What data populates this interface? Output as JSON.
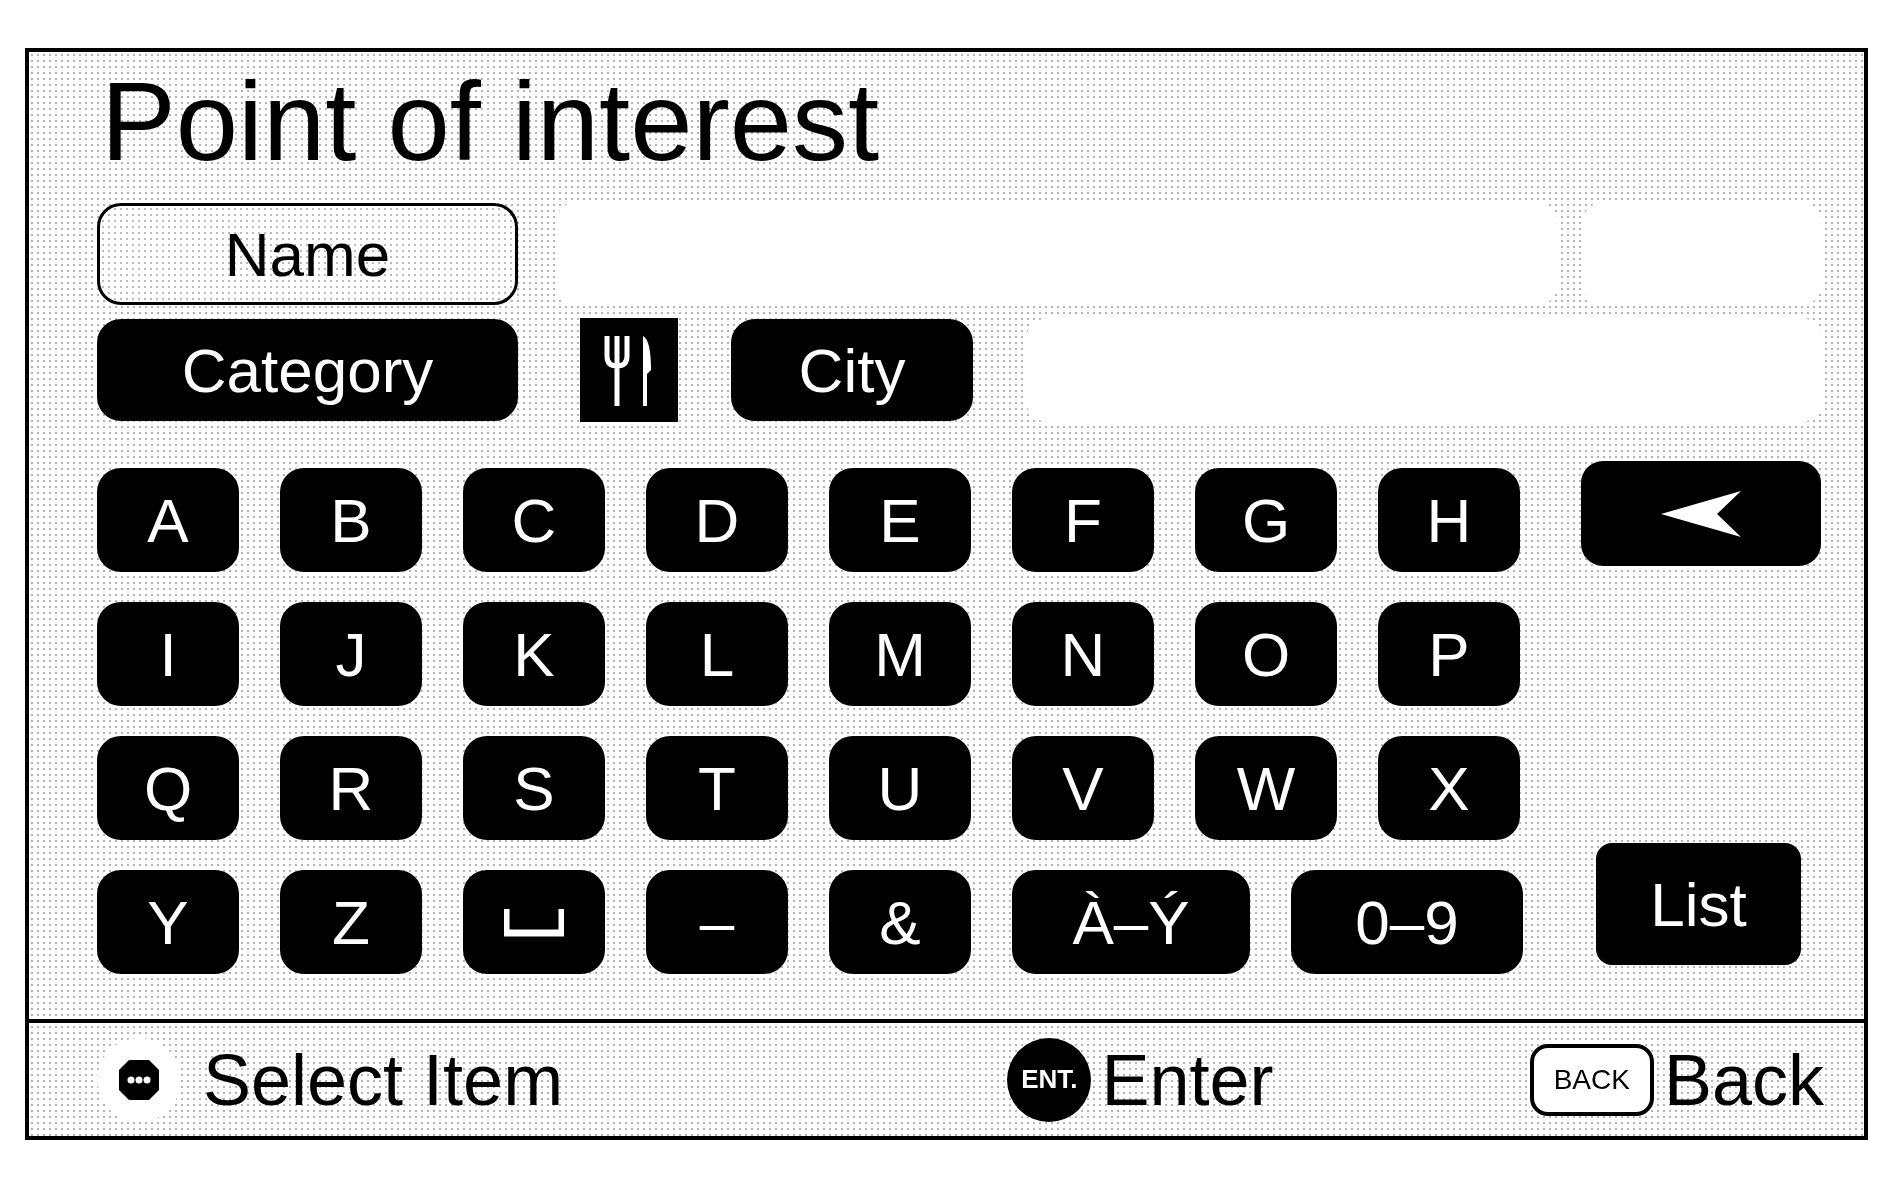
{
  "title": "Point of interest",
  "name_button": {
    "label": "Name",
    "selected": true
  },
  "category_button": {
    "label": "Category",
    "selected": false
  },
  "city_button": {
    "label": "City",
    "selected": false
  },
  "keyboard": {
    "letter_rows": [
      [
        {
          "kind": "letter",
          "label": "A"
        },
        {
          "kind": "letter",
          "label": "B"
        },
        {
          "kind": "letter",
          "label": "C"
        },
        {
          "kind": "letter",
          "label": "D"
        },
        {
          "kind": "letter",
          "label": "E"
        },
        {
          "kind": "letter",
          "label": "F"
        },
        {
          "kind": "letter",
          "label": "G"
        },
        {
          "kind": "letter",
          "label": "H"
        }
      ],
      [
        {
          "kind": "letter",
          "label": "I"
        },
        {
          "kind": "letter",
          "label": "J"
        },
        {
          "kind": "letter",
          "label": "K"
        },
        {
          "kind": "letter",
          "label": "L"
        },
        {
          "kind": "letter",
          "label": "M"
        },
        {
          "kind": "letter",
          "label": "N"
        },
        {
          "kind": "letter",
          "label": "O"
        },
        {
          "kind": "letter",
          "label": "P"
        }
      ],
      [
        {
          "kind": "letter",
          "label": "Q"
        },
        {
          "kind": "letter",
          "label": "R"
        },
        {
          "kind": "letter",
          "label": "S"
        },
        {
          "kind": "letter",
          "label": "T"
        },
        {
          "kind": "letter",
          "label": "U"
        },
        {
          "kind": "letter",
          "label": "V"
        },
        {
          "kind": "letter",
          "label": "W"
        },
        {
          "kind": "letter",
          "label": "X"
        }
      ]
    ],
    "bottom_keys": [
      {
        "kind": "letter",
        "label": "Y"
      },
      {
        "kind": "letter",
        "label": "Z"
      },
      {
        "kind": "space"
      },
      {
        "kind": "letter",
        "label": "–"
      },
      {
        "kind": "letter",
        "label": "&"
      },
      {
        "kind": "wide",
        "label": "À–Ý"
      },
      {
        "kind": "wide",
        "label": "0–9"
      }
    ],
    "list_button": {
      "label": "List"
    }
  },
  "footer": [
    {
      "kind": "joystick",
      "label": "Select Item"
    },
    {
      "kind": "ent",
      "badge": "ENT.",
      "label": "Enter"
    },
    {
      "kind": "back",
      "badge": "BACK",
      "label": "Back"
    }
  ]
}
